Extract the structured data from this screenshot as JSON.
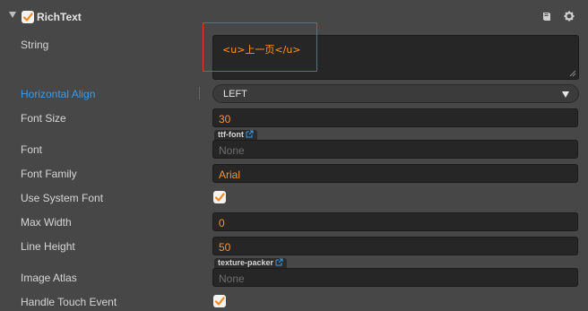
{
  "component": {
    "title": "RichText",
    "enabled": true
  },
  "props": {
    "string_label": "String",
    "string_value": "<u>上一页</u>",
    "halign_label": "Horizontal Align",
    "halign_value": "LEFT",
    "font_size_label": "Font Size",
    "font_size_value": "30",
    "font_label": "Font",
    "font_tag": "ttf-font",
    "font_value": "None",
    "font_family_label": "Font Family",
    "font_family_value": "Arial",
    "use_system_font_label": "Use System Font",
    "use_system_font_checked": true,
    "max_width_label": "Max Width",
    "max_width_value": "0",
    "line_height_label": "Line Height",
    "line_height_value": "50",
    "image_atlas_label": "Image Atlas",
    "image_atlas_tag": "texture-packer",
    "image_atlas_value": "None",
    "handle_touch_label": "Handle Touch Event",
    "handle_touch_checked": true
  },
  "colors": {
    "background": "#474747",
    "value_orange": "#fd942b",
    "label_blue": "#3c9be8",
    "check_orange": "#f08a1e",
    "highlight_red": "#e03a3a"
  },
  "icons": {
    "header_fold": "triangle-down-icon",
    "help": "book-icon",
    "settings": "gear-icon",
    "link": "external-link-icon"
  }
}
